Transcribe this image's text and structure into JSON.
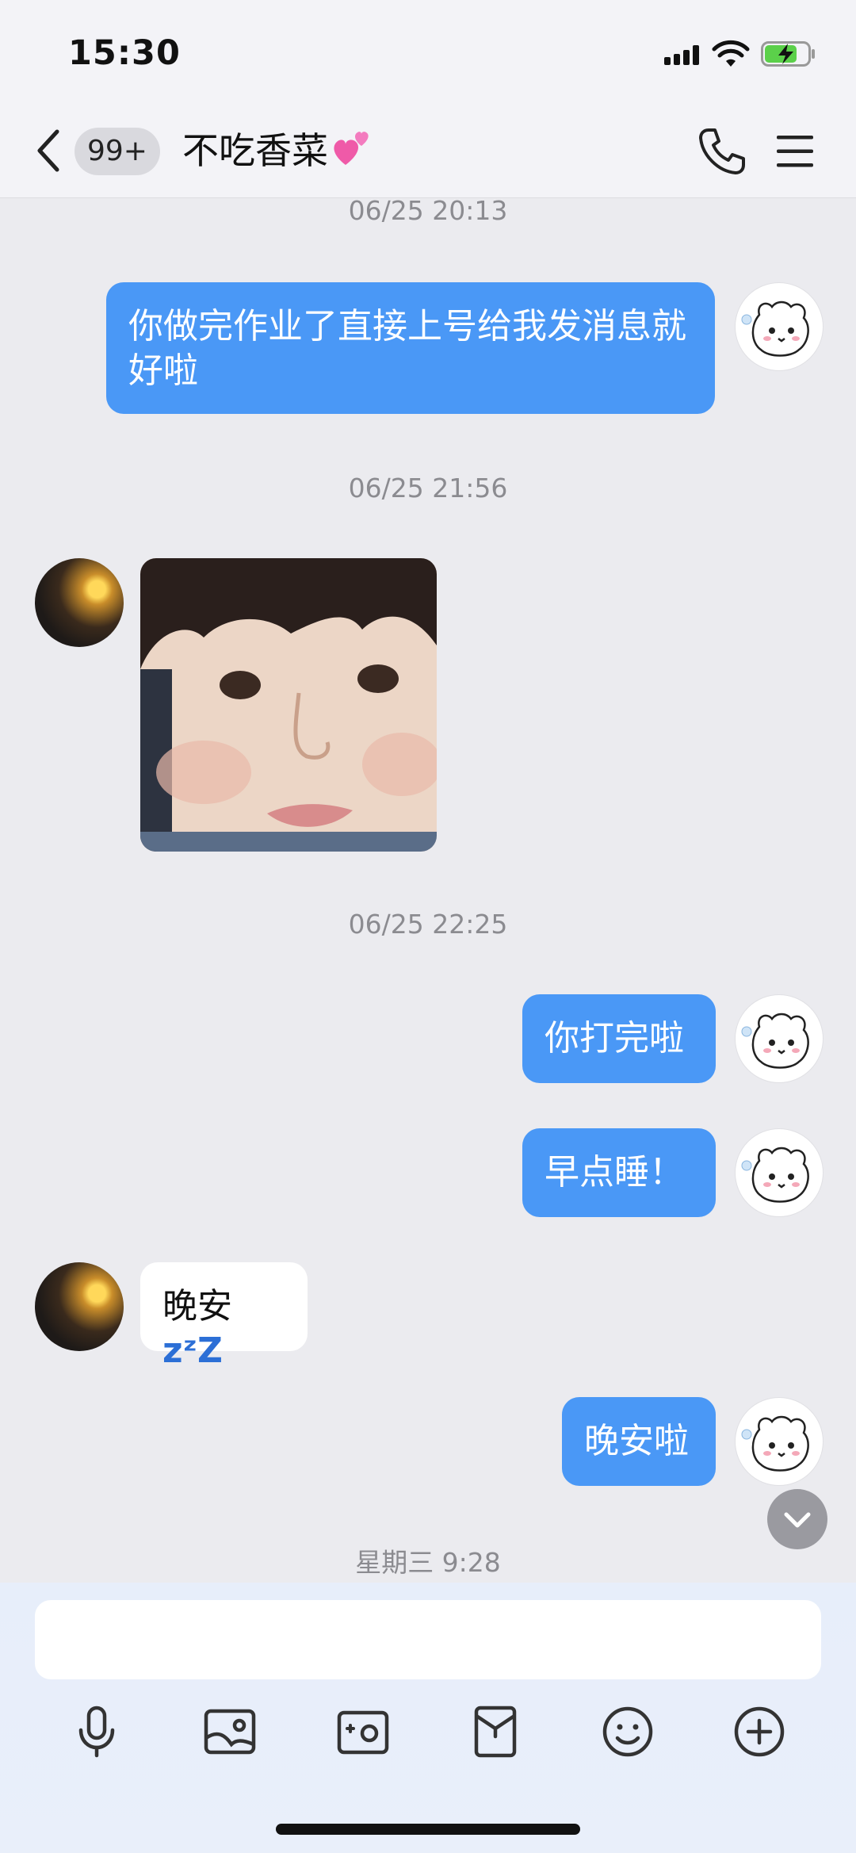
{
  "status_bar": {
    "time": "15:30"
  },
  "header": {
    "unread_badge": "99+",
    "title": "不吃香菜"
  },
  "messages": {
    "t1": "06/25 20:13",
    "m1": "你做完作业了直接上号给我发消息就好啦",
    "t2": "06/25 21:56",
    "t3": "06/25 22:25",
    "m2": "你打完啦",
    "m3": "早点睡！",
    "m4_text": "晚安",
    "m4_suffix": "zᶻZ",
    "m5": "晚安啦",
    "t4": "星期三 9:28"
  },
  "input": {
    "placeholder": ""
  },
  "colors": {
    "accent": "#4a98f6",
    "background": "#ebebef",
    "bubble_in": "#ffffff"
  }
}
